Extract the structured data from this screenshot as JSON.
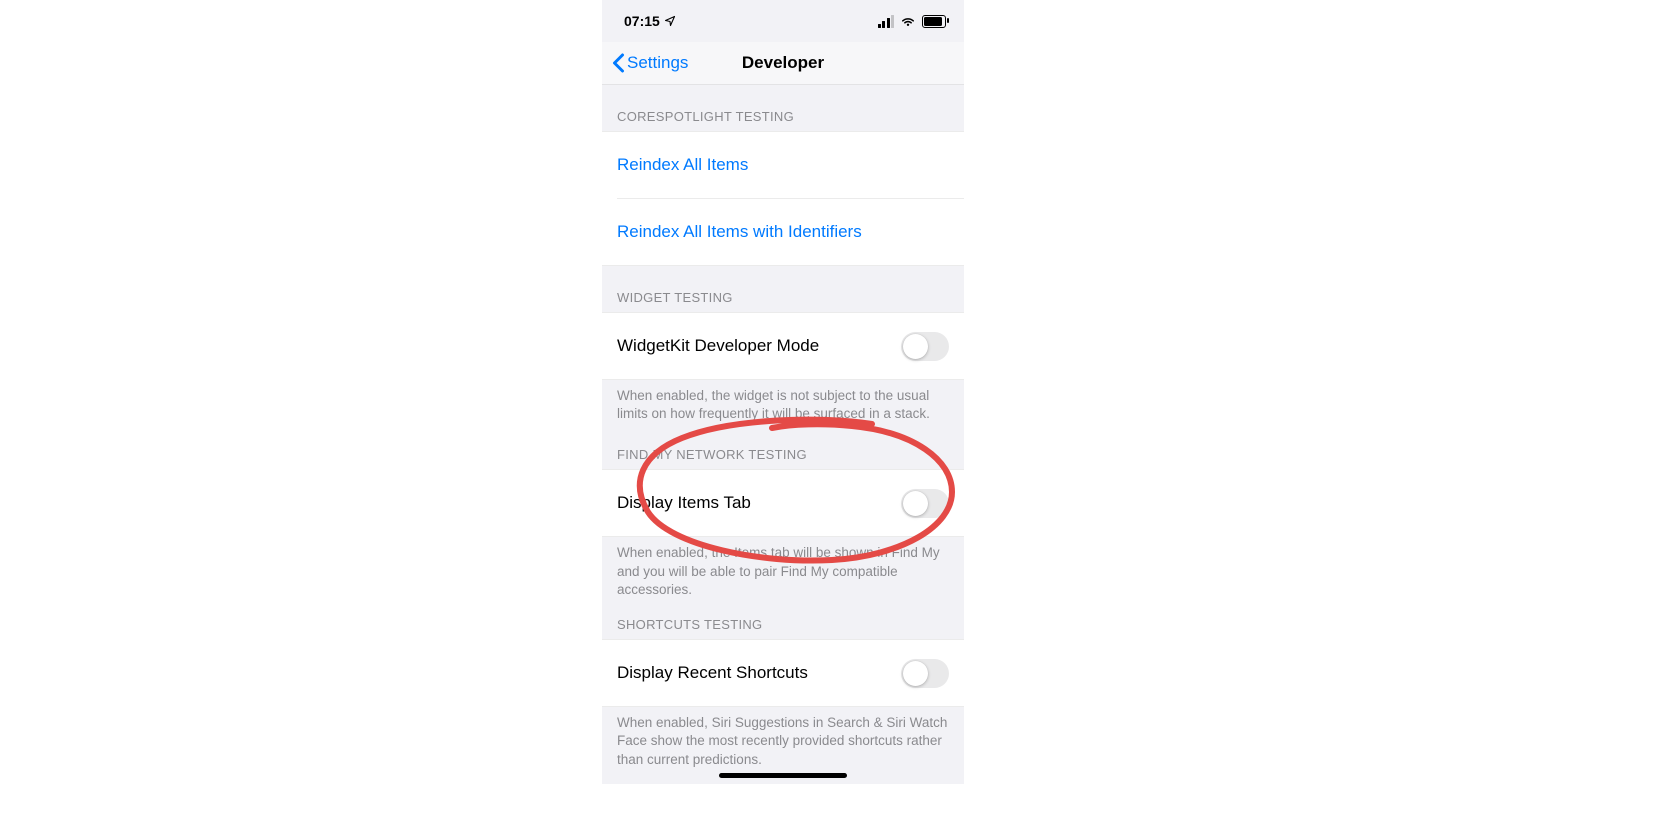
{
  "statusbar": {
    "time": "07:15"
  },
  "nav": {
    "back_label": "Settings",
    "title": "Developer"
  },
  "sections": {
    "corespotlight": {
      "header": "CORESPOTLIGHT TESTING",
      "reindex_all": "Reindex All Items",
      "reindex_ids": "Reindex All Items with Identifiers"
    },
    "widget": {
      "header": "WIDGET TESTING",
      "row_label": "WidgetKit Developer Mode",
      "footer": "When enabled, the widget is not subject to the usual limits on how frequently it will be surfaced in a stack."
    },
    "findmy": {
      "header": "FIND MY NETWORK TESTING",
      "row_label": "Display Items Tab",
      "footer": "When enabled, the Items tab will be shown in Find My and you will be able to pair Find My compatible accessories."
    },
    "shortcuts": {
      "header": "SHORTCUTS TESTING",
      "row_label": "Display Recent Shortcuts",
      "footer": "When enabled, Siri Suggestions in Search & Siri Watch Face show the most recently provided shortcuts rather than current predictions."
    }
  }
}
